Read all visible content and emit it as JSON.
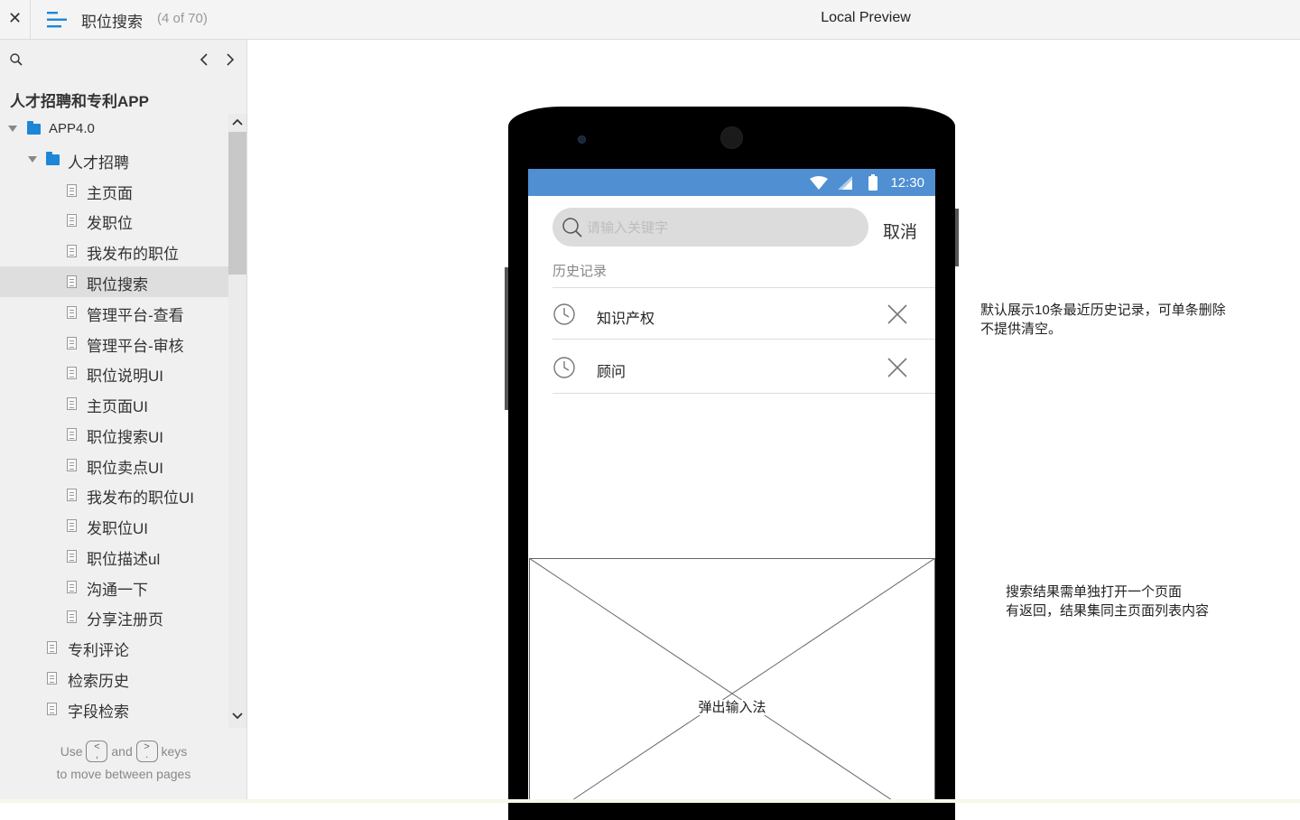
{
  "topbar": {
    "close_icon": "close-icon",
    "menu_icon": "hamburger-icon",
    "page_title": "职位搜索",
    "page_count": "(4 of 70)",
    "preview_label": "Local Preview"
  },
  "sidebar": {
    "project_title": "人才招聘和专利APP",
    "tree": [
      {
        "label": "APP4.0",
        "type": "folder",
        "level": 0,
        "expanded": true
      },
      {
        "label": "人才招聘",
        "type": "folder",
        "level": 1,
        "expanded": true
      },
      {
        "label": "主页面",
        "type": "page",
        "level": 2
      },
      {
        "label": "发职位",
        "type": "page",
        "level": 2
      },
      {
        "label": "我发布的职位",
        "type": "page",
        "level": 2
      },
      {
        "label": "职位搜索",
        "type": "page",
        "level": 2,
        "selected": true
      },
      {
        "label": "管理平台-查看",
        "type": "page",
        "level": 2
      },
      {
        "label": "管理平台-审核",
        "type": "page",
        "level": 2
      },
      {
        "label": "职位说明UI",
        "type": "page",
        "level": 2
      },
      {
        "label": "主页面UI",
        "type": "page",
        "level": 2
      },
      {
        "label": "职位搜索UI",
        "type": "page",
        "level": 2
      },
      {
        "label": "职位卖点UI",
        "type": "page",
        "level": 2
      },
      {
        "label": "我发布的职位UI",
        "type": "page",
        "level": 2
      },
      {
        "label": "发职位UI",
        "type": "page",
        "level": 2
      },
      {
        "label": "职位描述ul",
        "type": "page",
        "level": 2
      },
      {
        "label": "沟通一下",
        "type": "page",
        "level": 2
      },
      {
        "label": "分享注册页",
        "type": "page",
        "level": 2
      },
      {
        "label": "专利评论",
        "type": "page",
        "level": 1
      },
      {
        "label": "检索历史",
        "type": "page",
        "level": 1
      },
      {
        "label": "字段检索",
        "type": "page",
        "level": 1
      }
    ],
    "hint": {
      "use": "Use",
      "and": "and",
      "keys": "keys",
      "line2": "to move between pages"
    }
  },
  "phone": {
    "status_time": "12:30",
    "search_placeholder": "请输入关键字",
    "cancel_label": "取消",
    "history_title": "历史记录",
    "history_items": [
      "知识产权",
      "顾问"
    ],
    "keyboard_label": "弹出输入法"
  },
  "notes": {
    "note1": "默认展示10条最近历史记录，可单条删除不提供清空。",
    "note2_line1": "搜索结果需单独打开一个页面",
    "note2_line2": "有返回，结果集同主页面列表内容"
  },
  "colors": {
    "statusbar": "#4f8fd2",
    "folder": "#1d86d6",
    "accent": "#1d86d6"
  }
}
